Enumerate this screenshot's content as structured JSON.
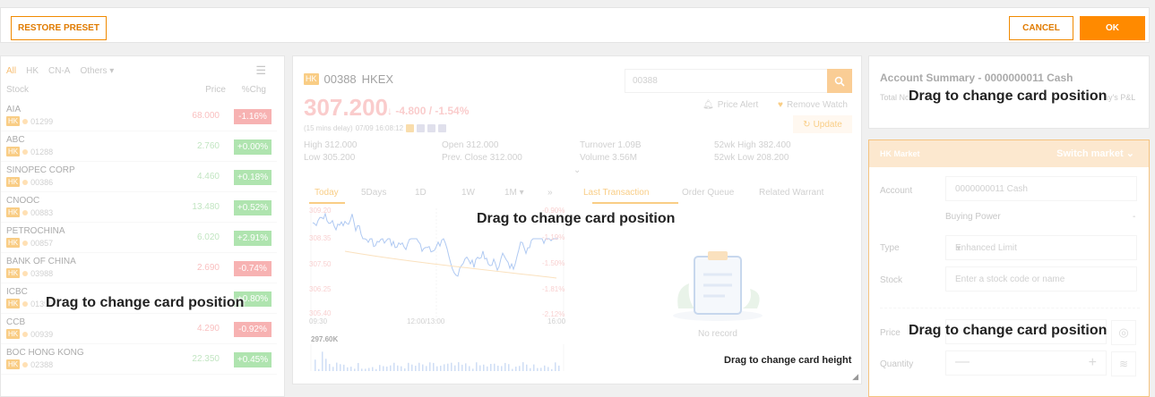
{
  "toolbar": {
    "restore_label": "RESTORE PRESET",
    "cancel_label": "CANCEL",
    "ok_label": "OK"
  },
  "overlays": {
    "drag_position": "Drag to change card position",
    "drag_height": "Drag to change card height"
  },
  "watchlist": {
    "tabs": [
      "All",
      "HK",
      "CN-A",
      "Others"
    ],
    "columns": {
      "stock": "Stock",
      "price": "Price",
      "chg": "%Chg"
    },
    "market_tag": "HK",
    "rows": [
      {
        "name": "AIA",
        "code": "01299",
        "price": "68.000",
        "chg": "-1.16%",
        "dir": "dn"
      },
      {
        "name": "ABC",
        "code": "01288",
        "price": "2.760",
        "chg": "+0.00%",
        "dir": "up"
      },
      {
        "name": "SINOPEC CORP",
        "code": "00386",
        "price": "4.460",
        "chg": "+0.18%",
        "dir": "up"
      },
      {
        "name": "CNOOC",
        "code": "00883",
        "price": "13.480",
        "chg": "+0.52%",
        "dir": "up"
      },
      {
        "name": "PETROCHINA",
        "code": "00857",
        "price": "6.020",
        "chg": "+2.91%",
        "dir": "up"
      },
      {
        "name": "BANK OF CHINA",
        "code": "03988",
        "price": "2.690",
        "chg": "-0.74%",
        "dir": "dn"
      },
      {
        "name": "ICBC",
        "code": "01398",
        "price": "",
        "chg": "+0.80%",
        "dir": "up"
      },
      {
        "name": "CCB",
        "code": "00939",
        "price": "4.290",
        "chg": "-0.92%",
        "dir": "dn"
      },
      {
        "name": "BOC HONG KONG",
        "code": "02388",
        "price": "22.350",
        "chg": "+0.45%",
        "dir": "up"
      }
    ]
  },
  "quote": {
    "market_tag": "HK",
    "code": "00388",
    "exchange": "HKEX",
    "search_value": "00388",
    "price": "307.200",
    "arrow": "↓",
    "change": "-4.800 / -1.54%",
    "delay": "(15 mins delay)",
    "timestamp": "07/09 16:08:12",
    "price_alert": "Price Alert",
    "remove_watch": "Remove Watch",
    "update": "Update",
    "stats": {
      "high": "High  312.000",
      "low": "Low  305.200",
      "open": "Open  312.000",
      "prev": "Prev. Close  312.000",
      "turnover": "Turnover  1.09B",
      "volume": "Volume  3.56M",
      "wk_high": "52wk High  382.400",
      "wk_low": "52wk Low  208.200"
    },
    "chart_tabs": [
      "Today",
      "5Days",
      "1D",
      "1W",
      "1M"
    ],
    "side_tabs": [
      "Last Transaction",
      "Order Queue",
      "Related Warrant"
    ],
    "axis": {
      "y_left": [
        "309.20",
        "308.35",
        "307.50",
        "306.25",
        "305.40"
      ],
      "y_right": [
        "-0.90%",
        "-1.19%",
        "-1.50%",
        "-1.81%",
        "-2.12%"
      ],
      "x": [
        "09:30",
        "12:00/13:00",
        "16:00"
      ],
      "volume": "297.60K"
    },
    "no_record": "No record"
  },
  "account": {
    "title": "Account Summary - 0000000011 Cash",
    "total_label": "Total No",
    "pl_label": "ay's P&L"
  },
  "order": {
    "market": "HK Market",
    "switch": "Switch market",
    "account_label": "Account",
    "account_value": "0000000011 Cash",
    "buying_power": "Buying Power",
    "buying_power_value": "-",
    "type_label": "Type",
    "type_value": "Enhanced Limit",
    "stock_label": "Stock",
    "stock_placeholder": "Enter a stock code or name",
    "price_label": "Price",
    "quantity_label": "Quantity"
  },
  "colors": {
    "accent": "#ff8a00",
    "up": "#6fcf6f",
    "down": "#f27474"
  }
}
